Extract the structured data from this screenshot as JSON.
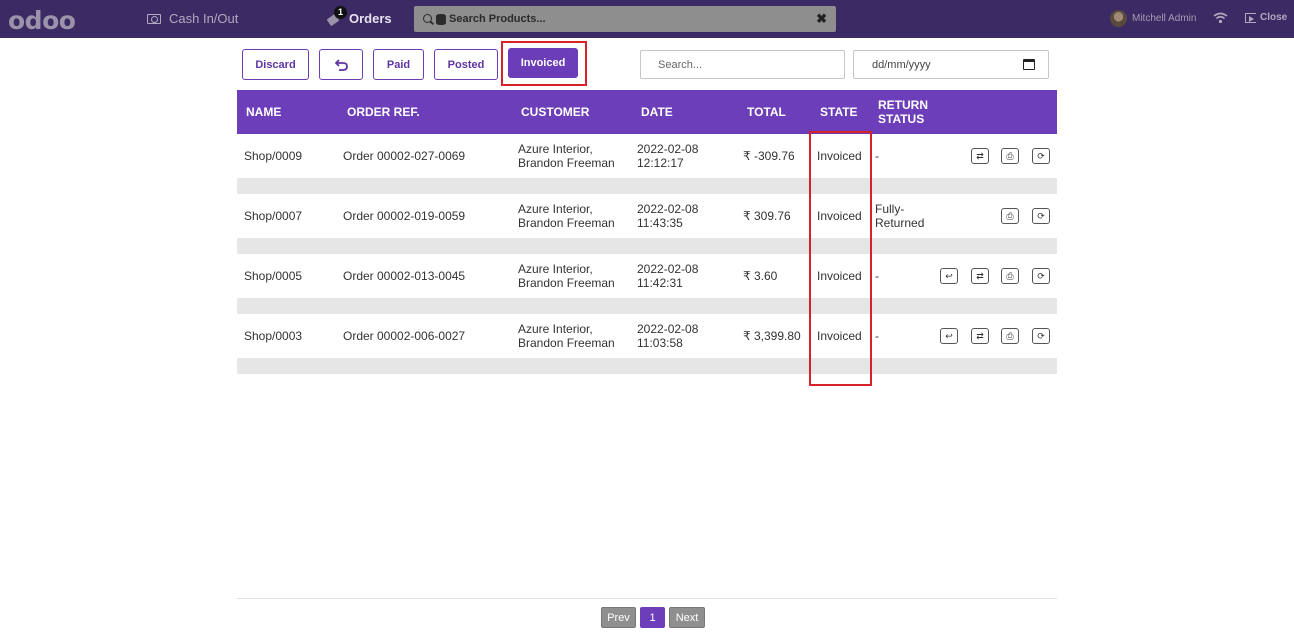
{
  "topbar": {
    "logo": "odoo",
    "cash_label": "Cash In/Out",
    "orders_label": "Orders",
    "orders_count": "1",
    "search_placeholder": "Search Products...",
    "user_name": "Mitchell Admin",
    "close_label": "Close"
  },
  "toolbar": {
    "discard": "Discard",
    "paid": "Paid",
    "posted": "Posted",
    "invoiced": "Invoiced",
    "search_placeholder": "Search...",
    "date_placeholder": "dd/mm/yyyy"
  },
  "table": {
    "headers": {
      "name": "NAME",
      "order_ref": "ORDER REF.",
      "customer": "CUSTOMER",
      "date": "DATE",
      "total": "TOTAL",
      "state": "STATE",
      "return_status_1": "RETURN",
      "return_status_2": "STATUS"
    },
    "rows": [
      {
        "name": "Shop/0009",
        "ref": "Order 00002-027-0069",
        "customer_1": "Azure Interior,",
        "customer_2": "Brandon Freeman",
        "date_1": "2022-02-08",
        "date_2": "12:12:17",
        "total": "₹ -309.76",
        "state": "Invoiced",
        "return_1": "-",
        "return_2": ""
      },
      {
        "name": "Shop/0007",
        "ref": "Order 00002-019-0059",
        "customer_1": "Azure Interior,",
        "customer_2": "Brandon Freeman",
        "date_1": "2022-02-08",
        "date_2": "11:43:35",
        "total": "₹ 309.76",
        "state": "Invoiced",
        "return_1": "Fully-",
        "return_2": "Returned"
      },
      {
        "name": "Shop/0005",
        "ref": "Order 00002-013-0045",
        "customer_1": "Azure Interior,",
        "customer_2": "Brandon Freeman",
        "date_1": "2022-02-08",
        "date_2": "11:42:31",
        "total": "₹ 3.60",
        "state": "Invoiced",
        "return_1": "-",
        "return_2": ""
      },
      {
        "name": "Shop/0003",
        "ref": "Order 00002-006-0027",
        "customer_1": "Azure Interior,",
        "customer_2": "Brandon Freeman",
        "date_1": "2022-02-08",
        "date_2": "11:03:58",
        "total": "₹ 3,399.80",
        "state": "Invoiced",
        "return_1": "-",
        "return_2": ""
      }
    ]
  },
  "pagination": {
    "prev": "Prev",
    "current": "1",
    "next": "Next"
  }
}
